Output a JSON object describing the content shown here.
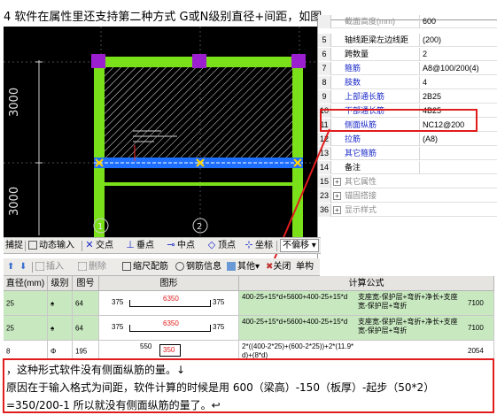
{
  "heading": "4 软件在属性里还支持第二种方式 G或N级别直径+间距，如图",
  "cad": {
    "dim_upper": "3000",
    "dim_lower": "3000",
    "axis_left": "1",
    "axis_mid": "2",
    "colors": {
      "background": "#000000",
      "column": "#7ae01a",
      "corner": "#9b1fcf",
      "beam": "#1f6fff",
      "hatch": "#e6e6e6"
    }
  },
  "properties": {
    "rows": [
      {
        "num": "",
        "expand": "",
        "name": "截面高度(mm)",
        "value": "600",
        "style": "grey"
      },
      {
        "num": "5",
        "expand": "",
        "name": "轴线距梁左边线距",
        "value": "(200)",
        "style": "normal"
      },
      {
        "num": "6",
        "expand": "",
        "name": "跨数量",
        "value": "2",
        "style": "normal"
      },
      {
        "num": "7",
        "expand": "",
        "name": "箍筋",
        "value": "A8@100/200(4)",
        "style": "blue"
      },
      {
        "num": "8",
        "expand": "",
        "name": "肢数",
        "value": "4",
        "style": "blue"
      },
      {
        "num": "9",
        "expand": "",
        "name": "上部通长筋",
        "value": "2B25",
        "style": "blue"
      },
      {
        "num": "10",
        "expand": "",
        "name": "下部通长筋",
        "value": "4B25",
        "style": "blue"
      },
      {
        "num": "11",
        "expand": "",
        "name": "侧面纵筋",
        "value": "NC12@200",
        "style": "blue"
      },
      {
        "num": "12",
        "expand": "",
        "name": "拉筋",
        "value": "(A8)",
        "style": "blue"
      },
      {
        "num": "13",
        "expand": "",
        "name": "其它箍筋",
        "value": "",
        "style": "blue"
      },
      {
        "num": "14",
        "expand": "",
        "name": "备注",
        "value": "",
        "style": "normal"
      },
      {
        "num": "15",
        "expand": "+",
        "name": "其它属性",
        "value": "",
        "style": "grey"
      },
      {
        "num": "23",
        "expand": "+",
        "name": "锚固搭接",
        "value": "",
        "style": "grey"
      },
      {
        "num": "36",
        "expand": "+",
        "name": "显示样式",
        "value": "",
        "style": "grey"
      }
    ]
  },
  "toolbar1": {
    "items": [
      "捕捉",
      "动态输入",
      "交点",
      "垂点",
      "中点",
      "顶点",
      "坐标",
      "不偏移"
    ]
  },
  "toolbar2": {
    "items": [
      "插入",
      "删除",
      "缩尺配筋",
      "钢筋信息",
      "其他",
      "关闭",
      "单构"
    ]
  },
  "table": {
    "headers": [
      "直径(mm)",
      "级别",
      "图号",
      "图形",
      "计算公式"
    ],
    "rows": [
      {
        "diameter": "25",
        "grade": "♠",
        "fig": "64",
        "left": "375",
        "mid": "6350",
        "right": "375",
        "formula": "400-25+15*d+5600+400-25+15*d",
        "desc": "支座宽-保护层+弯折+净长+支座宽-保护层+弯折",
        "total": "7100"
      },
      {
        "diameter": "25",
        "grade": "♠",
        "fig": "64",
        "left": "375",
        "mid": "6350",
        "right": "375",
        "formula": "400-25+15*d+5600+400-25+15*d",
        "desc": "支座宽-保护层+弯折+净长+支座宽-保护层+弯折",
        "total": "7100"
      },
      {
        "diameter": "8",
        "grade": "Φ",
        "fig": "195",
        "left": "",
        "mid": "550",
        "right": "350",
        "formula": "2*((400-2*25)+(600-2*25))+2*(11.9*d)+(8*d)",
        "desc": "",
        "total": "2054"
      }
    ]
  },
  "note": {
    "line1": "，这种形式软件没有侧面纵筋的量。↓",
    "line2": "原因在于输入格式为间距，软件计算的时候是用 600（梁高）-150（板厚）-起步（50*2）",
    "line3": "=350/200-1 所以就没有侧面纵筋的量了。↩"
  }
}
